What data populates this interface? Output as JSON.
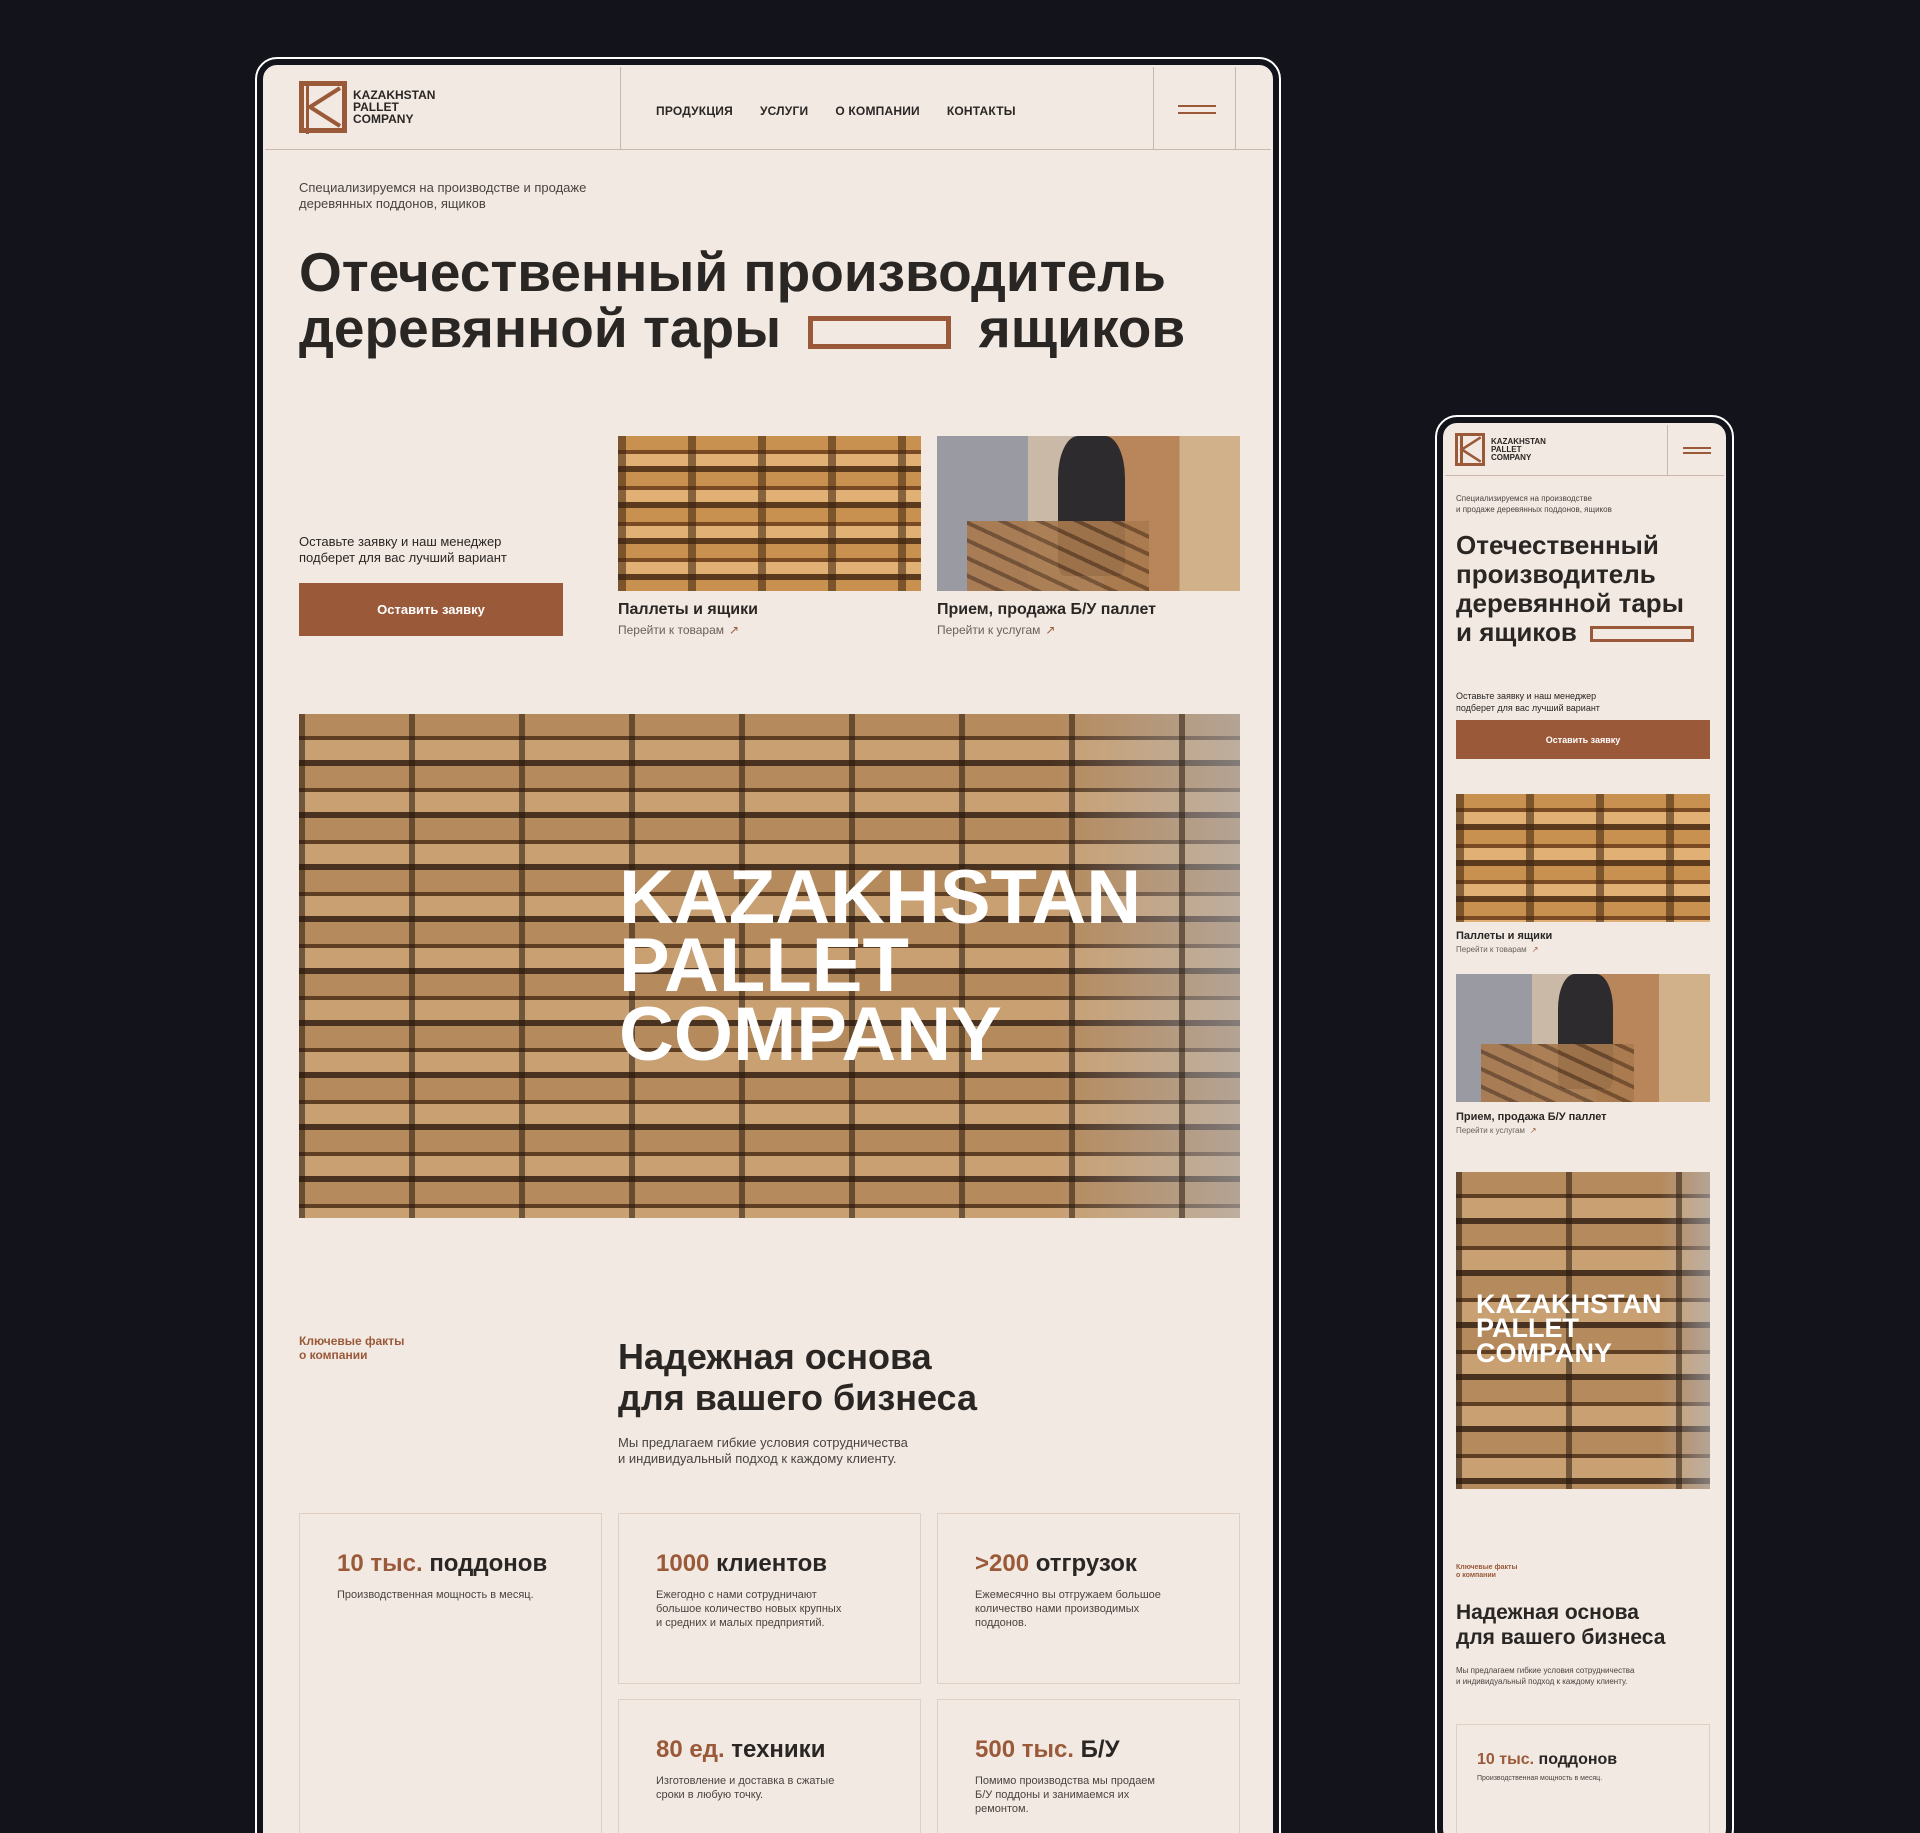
{
  "brand": {
    "line1": "KAZAKHSTAN",
    "line2": "PALLET",
    "line3": "COMPANY"
  },
  "nav": [
    "ПРОДУКЦИЯ",
    "УСЛУГИ",
    "О КОМПАНИИ",
    "КОНТАКТЫ"
  ],
  "tagline": {
    "line1": "Специализируемся на производстве и продаже",
    "line2": "деревянных поддонов, ящиков"
  },
  "hero": {
    "line1": "Отечественный производитель",
    "line2a": "деревянной тары",
    "line2b": "ящиков"
  },
  "mobile_hero": {
    "line1": "Отечественный",
    "line2": "производитель",
    "line3": "деревянной тары",
    "line4": "и ящиков"
  },
  "mobile_tagline": {
    "line1": "Специализируемся на производстве",
    "line2": "и продаже деревянных поддонов, ящиков"
  },
  "cta": {
    "text1": "Оставьте заявку и наш менеджер",
    "text2": "подберет для вас лучший вариант",
    "button": "Оставить заявку"
  },
  "cards": [
    {
      "title": "Паллеты и ящики",
      "link": "Перейти к товарам"
    },
    {
      "title": "Прием, продажа Б/У паллет",
      "link": "Перейти к услугам"
    }
  ],
  "arrow": "↗",
  "banner": {
    "line1": "KAZAKHSTAN",
    "line2": "PALLET",
    "line3": "COMPANY"
  },
  "facts": {
    "label1": "Ключевые факты",
    "label2": "о компании",
    "title1": "Надежная основа",
    "title2": "для вашего бизнеса",
    "sub1": "Мы предлагаем гибкие условия сотрудничества",
    "sub2": "и индивидуальный подход к каждому клиенту."
  },
  "stats": [
    {
      "num": "10 тыс.",
      "unit": "поддонов",
      "desc": [
        "Производственная мощность в месяц."
      ]
    },
    {
      "num": "1000",
      "unit": "клиентов",
      "desc": [
        "Ежегодно с нами сотрудничают",
        "большое количество новых крупных",
        "и средних и малых предприятий."
      ]
    },
    {
      "num": ">200",
      "unit": "отгрузок",
      "desc": [
        "Ежемесячно вы отгружаем большое",
        "количество нами производимых",
        "поддонов."
      ]
    },
    {
      "num": "80 ед.",
      "unit": "техники",
      "desc": [
        "Изготовление и доставка в сжатые",
        "сроки в любую точку."
      ]
    },
    {
      "num": "500 тыс.",
      "unit": "Б/У",
      "desc": [
        "Помимо производства мы продаем",
        "Б/У поддоны и занимаемся их",
        "ремонтом."
      ]
    }
  ],
  "colors": {
    "accent": "#9a5a3a",
    "background": "#f2e9e2",
    "page_bg": "#12131b"
  }
}
